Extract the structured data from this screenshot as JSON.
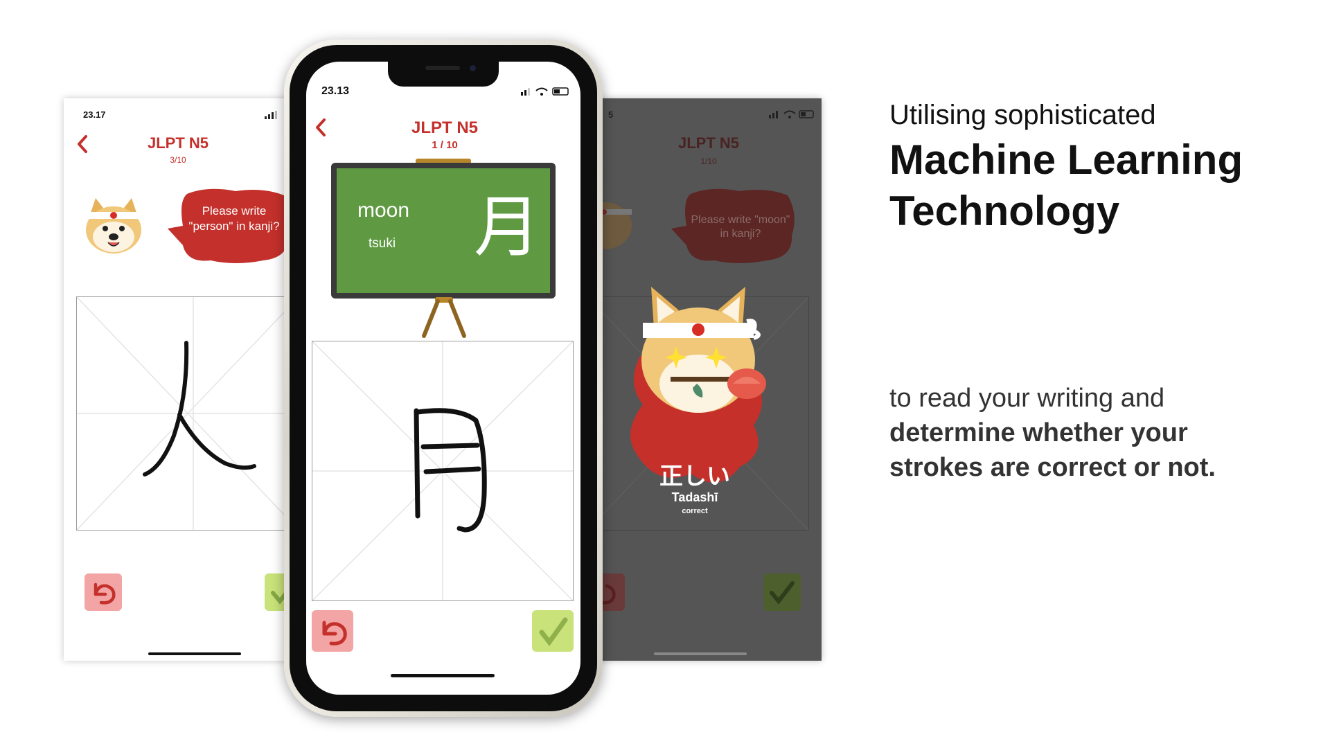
{
  "left_phone": {
    "status_time": "23.17",
    "title": "JLPT N5",
    "progress": "3/10",
    "bubble_text": "Please write \"person\" in kanji?",
    "drawn_kanji": "人"
  },
  "center_phone": {
    "status_time": "23.13",
    "title": "JLPT N5",
    "progress": "1 / 10",
    "card_english": "moon",
    "card_romaji": "tsuki",
    "card_kanji": "月",
    "drawn_kanji": "月"
  },
  "right_phone": {
    "status_time": "5",
    "title": "JLPT N5",
    "progress": "1/10",
    "bubble_text": "Please write \"moon\" in kanji?",
    "result_kanji": "正しい",
    "result_romaji": "Tadashī",
    "result_label": "correct"
  },
  "marketing": {
    "line1": "Utilising sophisticated",
    "line2": "Machine Learning",
    "line3": "Technology",
    "body_line1": "to read your writing and",
    "body_line2": "determine whether your",
    "body_line3": "strokes are correct or not."
  },
  "colors": {
    "accent_red": "#c4302b",
    "chalkboard_green": "#5f9a43",
    "undo_pink": "#f3a5a5",
    "check_green": "#c9e27a"
  },
  "icons": [
    "back-chevron-icon",
    "undo-icon",
    "check-icon",
    "signal-icon",
    "wifi-icon",
    "battery-icon",
    "shiba-mascot-icon"
  ]
}
